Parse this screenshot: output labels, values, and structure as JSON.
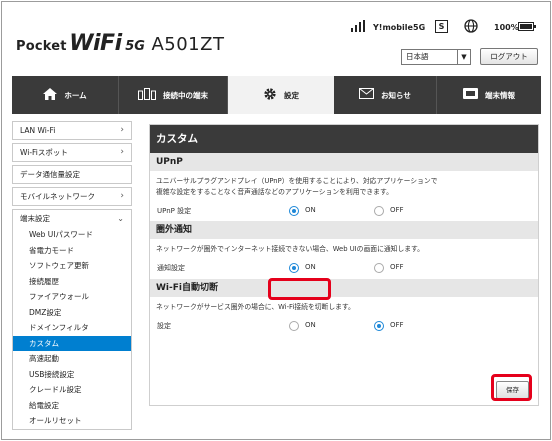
{
  "header": {
    "logo": {
      "pocket": "Pocket",
      "wifi": "WiFi",
      "fiveg": "5G",
      "model": "A501ZT"
    },
    "carrier": "Y!mobile",
    "network": "5G",
    "sim_label": "S",
    "battery_pct": "100%",
    "battery_level": 1.0,
    "language": "日本語",
    "logout": "ログアウト"
  },
  "nav": {
    "tabs": [
      {
        "label": "ホーム",
        "icon": "home-icon"
      },
      {
        "label": "接続中の端末",
        "icon": "devices-icon"
      },
      {
        "label": "設定",
        "icon": "gear-icon",
        "active": true
      },
      {
        "label": "お知らせ",
        "icon": "mail-icon"
      },
      {
        "label": "端末情報",
        "icon": "device-info-icon"
      }
    ]
  },
  "sidebar": {
    "items": [
      {
        "label": "LAN Wi-Fi"
      },
      {
        "label": "Wi-Fiスポット"
      },
      {
        "label": "データ通信量設定"
      },
      {
        "label": "モバイルネットワーク"
      }
    ],
    "group": {
      "label": "端末設定",
      "subs": [
        "Web UIパスワード",
        "省電力モード",
        "ソフトウェア更新",
        "接続履歴",
        "ファイアウォール",
        "DMZ設定",
        "ドメインフィルタ",
        "カスタム",
        "高速起動",
        "USB接続設定",
        "クレードル設定",
        "給電設定",
        "オールリセット"
      ],
      "active_index": 7
    }
  },
  "main": {
    "title": "カスタム",
    "upnp": {
      "heading": "UPnP",
      "desc_line1": "ユニバーサルプラグアンドプレイ（UPnP）を使用することにより、対応アプリケーションで",
      "desc_line2": "複雑な設定をすることなく音声通話などのアプリケーションを利用できます。",
      "label": "UPnP 設定",
      "on": "ON",
      "off": "OFF"
    },
    "outside": {
      "heading": "圏外通知",
      "desc": "ネットワークが圏外でインターネット接続できない場合、Web UIの画面に通知します。",
      "label": "通知設定",
      "on": "ON",
      "off": "OFF"
    },
    "wifi_auto": {
      "heading": "Wi-Fi自動切断",
      "desc": "ネットワークがサービス圏外の場合に、Wi-Fi接続を切断します。",
      "label": "設定",
      "on": "ON",
      "off": "OFF"
    },
    "save": "保存"
  }
}
